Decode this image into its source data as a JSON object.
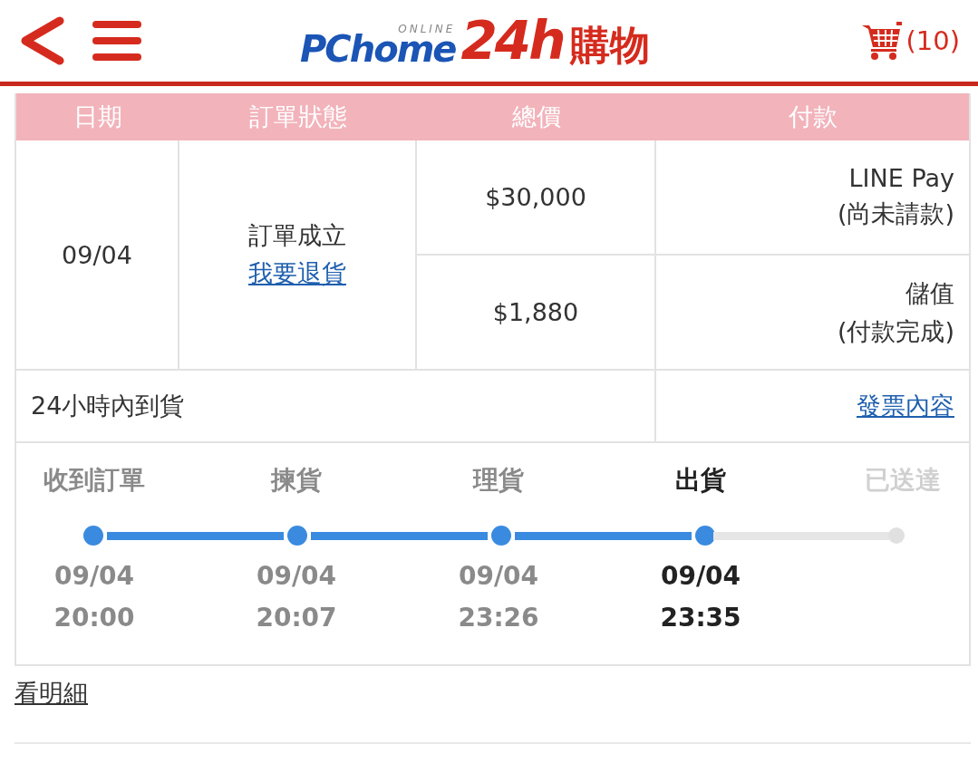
{
  "header": {
    "logo": {
      "brand": "PChome",
      "online": "ONLINE",
      "big": "24h",
      "suffix": "購物"
    },
    "cart_count": "(10)"
  },
  "table": {
    "columns": [
      "日期",
      "訂單狀態",
      "總價",
      "付款"
    ],
    "date": "09/04",
    "status": "訂單成立",
    "return_link": "我要退貨",
    "payments": [
      {
        "amount": "$30,000",
        "method": "LINE Pay",
        "note": "(尚未請款)"
      },
      {
        "amount": "$1,880",
        "method": "儲值",
        "note": "(付款完成)"
      }
    ],
    "delivery": "24小時內到貨",
    "invoice_link": "發票內容"
  },
  "timeline": [
    {
      "label": "收到訂單",
      "date": "09/04",
      "time": "20:00",
      "kind": "done"
    },
    {
      "label": "揀貨",
      "date": "09/04",
      "time": "20:07",
      "kind": "done"
    },
    {
      "label": "理貨",
      "date": "09/04",
      "time": "23:26",
      "kind": "done"
    },
    {
      "label": "出貨",
      "date": "09/04",
      "time": "23:35",
      "kind": "current"
    },
    {
      "label": "已送達",
      "kind": "pending"
    }
  ],
  "details_link": "看明細"
}
